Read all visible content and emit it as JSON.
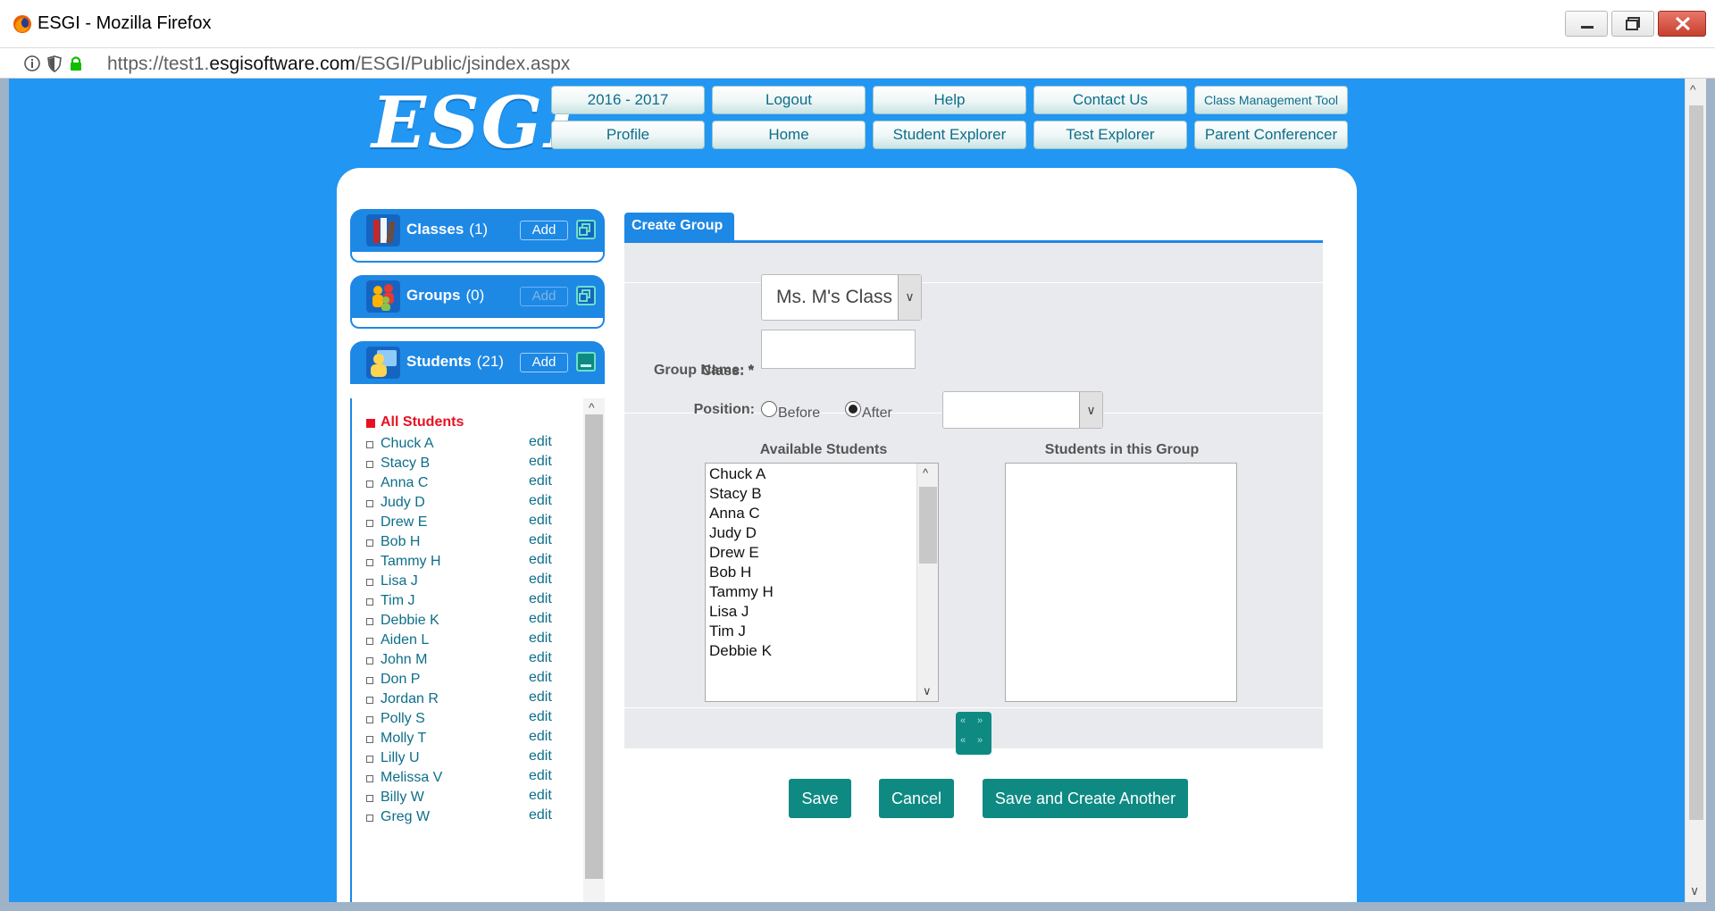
{
  "window": {
    "title": "ESGI - Mozilla Firefox"
  },
  "urlbar": {
    "prefix": "https://test1.",
    "domain": "esgisoftware.com",
    "path": "/ESGI/Public/jsindex.aspx"
  },
  "logo": {
    "text": "ESGI"
  },
  "nav": {
    "row1": [
      "2016 - 2017",
      "Logout",
      "Help",
      "Contact Us",
      "Class Management Tool"
    ],
    "row2": [
      "Profile",
      "Home",
      "Student Explorer",
      "Test Explorer",
      "Parent Conferencer"
    ]
  },
  "sidebar": {
    "classes": {
      "title": "Classes",
      "count": "(1)",
      "add": "Add"
    },
    "groups": {
      "title": "Groups",
      "count": "(0)",
      "add": "Add"
    },
    "students": {
      "title": "Students",
      "count": "(21)",
      "add": "Add"
    },
    "all_students": "All Students",
    "edit_label": "edit",
    "student_names": [
      "Chuck A",
      "Stacy B",
      "Anna C",
      "Judy D",
      "Drew E",
      "Bob H",
      "Tammy H",
      "Lisa J",
      "Tim J",
      "Debbie K",
      "Aiden L",
      "John M",
      "Don P",
      "Jordan R",
      "Polly S",
      "Molly T",
      "Lilly U",
      "Melissa V",
      "Billy W",
      "Greg W"
    ]
  },
  "form": {
    "tab_title": "Create Group",
    "class_label": "Class: *",
    "class_value": "Ms. M's Class",
    "group_name_label": "Group Name: *",
    "group_name_value": "",
    "position_label": "Position:",
    "before_label": "Before",
    "after_label": "After",
    "position_selected": "After",
    "position_select_value": "",
    "available_head": "Available Students",
    "in_group_head": "Students in this Group",
    "available": [
      "Chuck A",
      "Stacy B",
      "Anna C",
      "Judy D",
      "Drew E",
      "Bob H",
      "Tammy H",
      "Lisa J",
      "Tim J",
      "Debbie K"
    ],
    "in_group": []
  },
  "buttons": {
    "save": "Save",
    "cancel": "Cancel",
    "save_another": "Save and Create Another"
  },
  "colors": {
    "page_bg": "#2196f3",
    "panel_blue": "#1e88e5",
    "teal": "#0e8a83",
    "link": "#0d6e8a",
    "all_students": "#e81123"
  }
}
